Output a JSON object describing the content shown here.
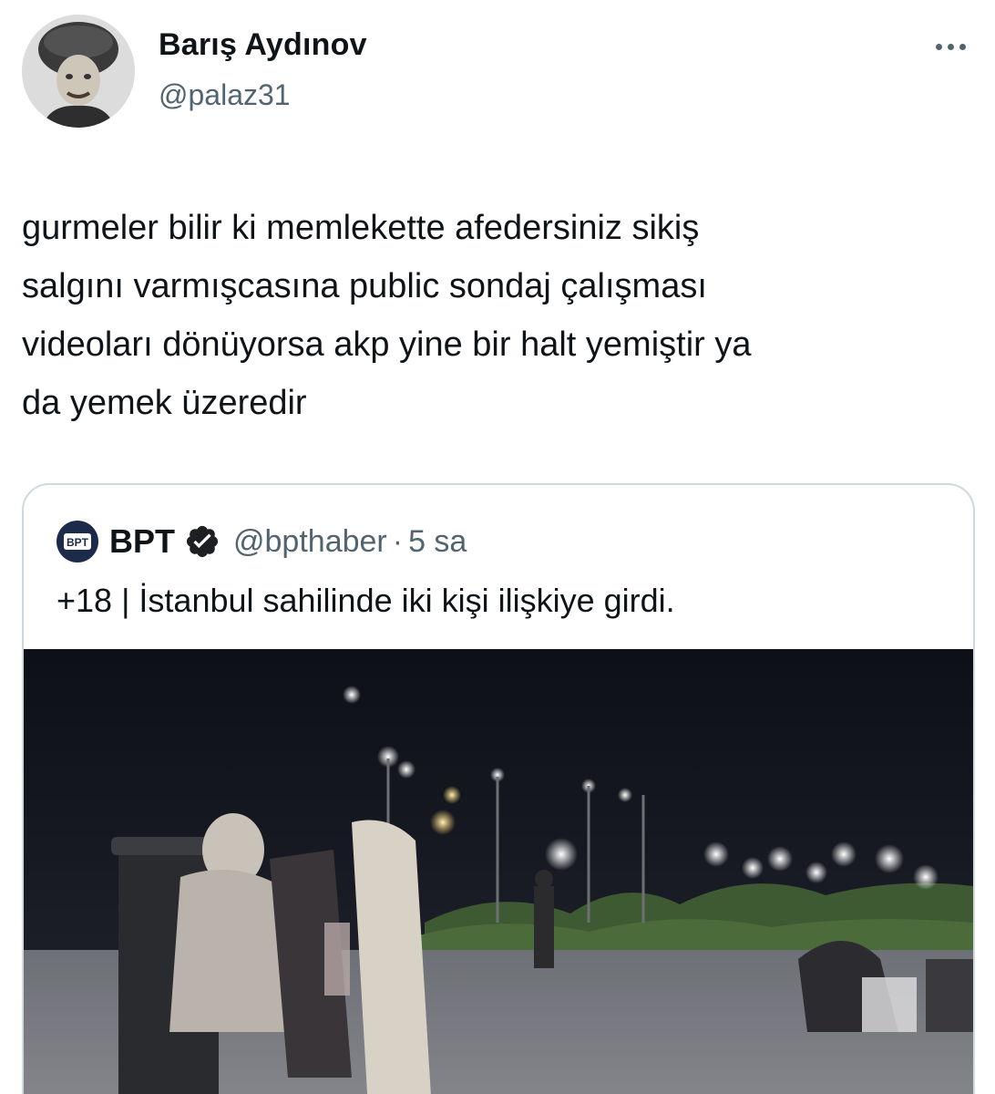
{
  "author": {
    "display_name": "Barış Aydınov",
    "handle": "@palaz31",
    "avatar_icon": "avatar-photo"
  },
  "menu": {
    "icon": "more-horizontal-icon"
  },
  "tweet": {
    "text": "gurmeler bilir ki memlekette afedersiniz sikiş\nsalgını varmışcasına public sondaj çalışması\nvideoları dönüyorsa akp yine bir halt yemiştir ya\nda yemek üzeredir"
  },
  "quote": {
    "name": "BPT",
    "logo_text": "BPT",
    "verified_icon": "verified-badge-icon",
    "handle": "@bpthaber",
    "separator": "·",
    "time": "5 sa",
    "text": "+18 | İstanbul sahilinde iki kişi ilişkiye girdi.",
    "media_icon": "video-thumbnail"
  },
  "colors": {
    "text_primary": "#0f1419",
    "text_secondary": "#536471",
    "border": "#cfd9de",
    "verified_badge": "#1d1f23"
  }
}
